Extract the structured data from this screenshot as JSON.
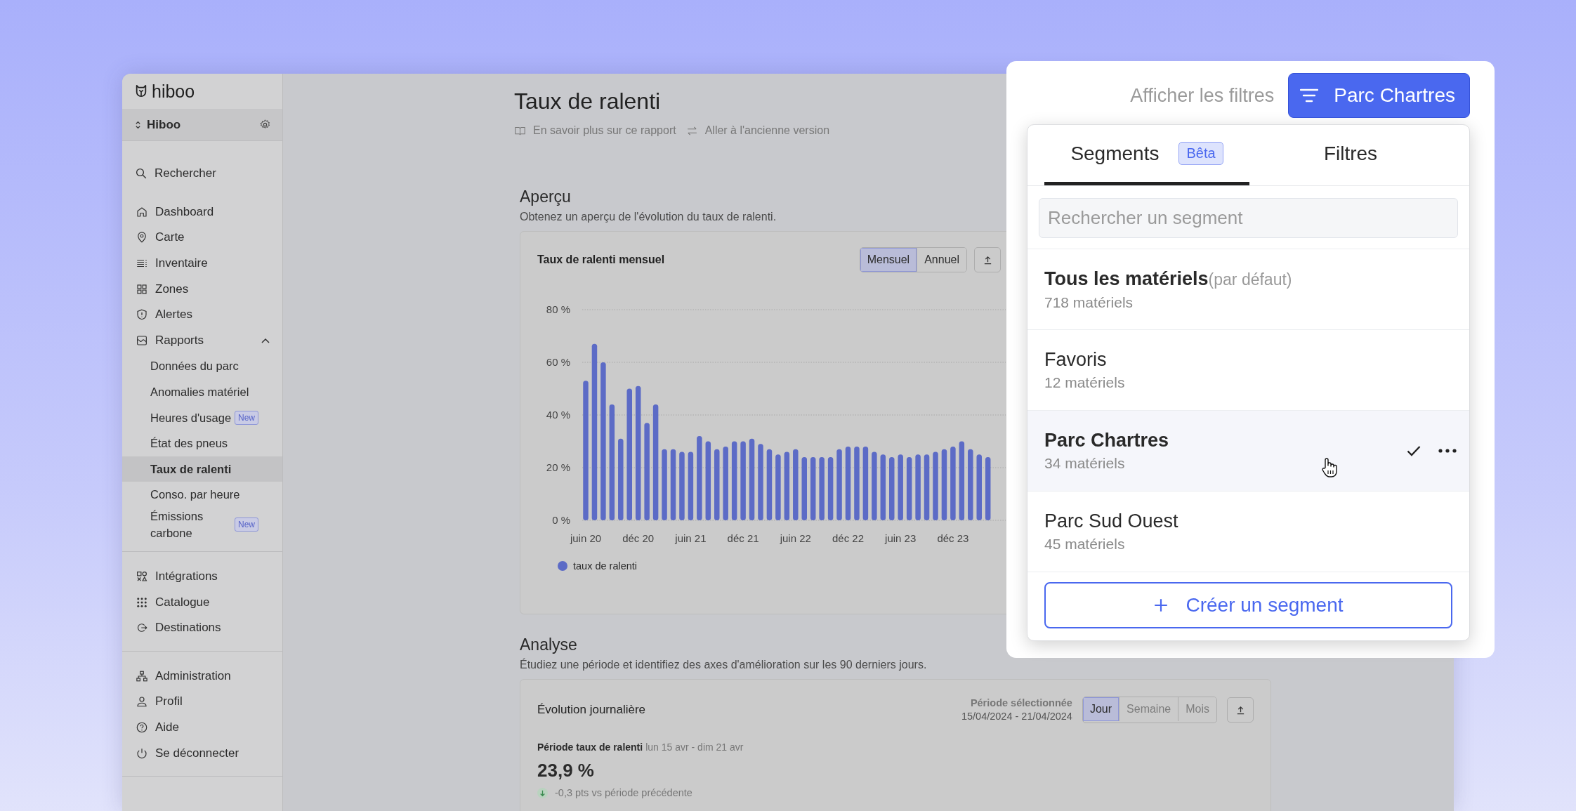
{
  "brand": {
    "name": "hiboo"
  },
  "workspace": {
    "name": "Hiboo"
  },
  "search": {
    "label": "Rechercher"
  },
  "nav": [
    {
      "label": "Dashboard"
    },
    {
      "label": "Carte"
    },
    {
      "label": "Inventaire"
    },
    {
      "label": "Zones"
    },
    {
      "label": "Alertes"
    },
    {
      "label": "Rapports",
      "expanded": true,
      "children": [
        {
          "label": "Données du parc",
          "selected": false
        },
        {
          "label": "Anomalies matériel",
          "selected": false
        },
        {
          "label": "Heures d'usage",
          "badge": "New",
          "selected": false
        },
        {
          "label": "État des pneus",
          "selected": false
        },
        {
          "label": "Taux de ralenti",
          "selected": true
        },
        {
          "label": "Conso. par heure",
          "selected": false
        },
        {
          "label": "Émissions carbone",
          "badge": "New",
          "selected": false
        }
      ]
    }
  ],
  "nav_secondary": [
    {
      "label": "Intégrations"
    },
    {
      "label": "Catalogue"
    },
    {
      "label": "Destinations"
    }
  ],
  "nav_account": [
    {
      "label": "Administration"
    },
    {
      "label": "Profil"
    },
    {
      "label": "Aide"
    },
    {
      "label": "Se déconnecter"
    }
  ],
  "page": {
    "title": "Taux de ralenti",
    "links": [
      {
        "label": "En savoir plus sur ce rapport"
      },
      {
        "label": "Aller à l'ancienne version"
      }
    ]
  },
  "overview": {
    "heading": "Aperçu",
    "subtitle": "Obtenez un aperçu de l'évolution du taux de ralenti.",
    "card": {
      "title": "Taux de ralenti mensuel",
      "periods": [
        {
          "label": "Mensuel",
          "selected": true
        },
        {
          "label": "Annuel",
          "selected": false
        }
      ],
      "chart_data": {
        "type": "bar",
        "ylim": [
          0,
          80
        ],
        "yticks": [
          {
            "value": 0,
            "label": "0 %"
          },
          {
            "value": 20,
            "label": "20 %"
          },
          {
            "value": 40,
            "label": "40 %"
          },
          {
            "value": 60,
            "label": "60 %"
          },
          {
            "value": 80,
            "label": "80 %"
          }
        ],
        "grid": true,
        "categories": [
          "juin 20",
          null,
          null,
          null,
          null,
          null,
          "déc 20",
          null,
          null,
          null,
          null,
          null,
          "juin 21",
          null,
          null,
          null,
          null,
          null,
          "déc 21",
          null,
          null,
          null,
          null,
          null,
          "juin 22",
          null,
          null,
          null,
          null,
          null,
          "déc 22",
          null,
          null,
          null,
          null,
          null,
          "juin 23",
          null,
          null,
          null,
          null,
          null,
          "déc 23",
          null,
          null,
          null,
          null
        ],
        "series": [
          {
            "name": "taux de ralenti",
            "color": "#5c6bc6",
            "values": [
              53,
              67,
              60,
              44,
              31,
              50,
              51,
              37,
              44,
              27,
              27,
              26,
              26,
              32,
              30,
              27,
              28,
              30,
              30,
              31,
              29,
              27,
              25,
              26,
              27,
              24,
              24,
              24,
              24,
              27,
              28,
              28,
              28,
              26,
              25,
              24,
              25,
              24,
              25,
              25,
              26,
              27,
              28,
              30,
              27,
              25,
              24
            ]
          }
        ]
      }
    }
  },
  "analysis": {
    "heading": "Analyse",
    "subtitle": "Étudiez une période et identifiez des axes d'amélioration sur les 90 derniers jours.",
    "card": {
      "title": "Évolution journalière",
      "period_label": "Période sélectionnée",
      "period_range": "15/04/2024 - 21/04/2024",
      "granularity": [
        {
          "label": "Jour",
          "selected": true,
          "disabled": false
        },
        {
          "label": "Semaine",
          "selected": false,
          "disabled": true
        },
        {
          "label": "Mois",
          "selected": false,
          "disabled": true
        }
      ],
      "metric_label": "Période taux de ralenti",
      "metric_range": "lun 15 avr - dim 21 avr",
      "metric_value": "23,9 %",
      "delta": "-0,3 pts vs période précédente"
    }
  },
  "filter_bar": {
    "show_filters": "Afficher les filtres",
    "segment_button": "Parc Chartres"
  },
  "segment_menu": {
    "tabs": [
      {
        "label": "Segments",
        "badge": "Bêta",
        "selected": true
      },
      {
        "label": "Filtres",
        "selected": false
      }
    ],
    "search": {
      "placeholder": "Rechercher un segment"
    },
    "segments": [
      {
        "name": "Tous les matériels",
        "note": "(par défaut)",
        "count": "718 matériels",
        "default": true,
        "selected": false
      },
      {
        "name": "Favoris",
        "count": "12 matériels",
        "default": false,
        "selected": false
      },
      {
        "name": "Parc Chartres",
        "count": "34 matériels",
        "default": false,
        "selected": true
      },
      {
        "name": "Parc Sud Ouest",
        "count": "45 matériels",
        "default": false,
        "selected": false
      }
    ],
    "create_button": "Créer un segment"
  }
}
